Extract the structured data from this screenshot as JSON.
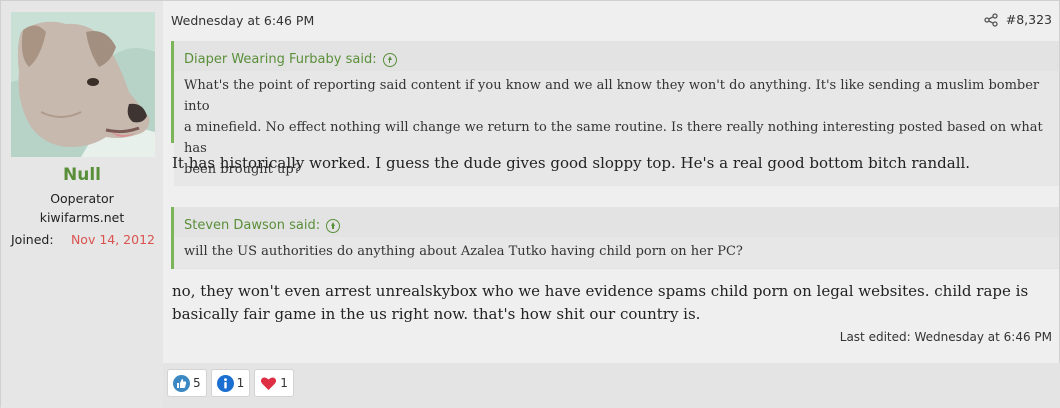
{
  "user": {
    "name": "Null",
    "title": "Ooperator",
    "site": "kiwifarms.net",
    "joined_label": "Joined:",
    "joined_value": "Nov 14, 2012"
  },
  "post": {
    "date": "Wednesday at 6:46 PM",
    "number": "#8,323",
    "quotes": [
      {
        "author": "Diaper Wearing Furbaby said:",
        "lines": [
          "What's the point of reporting said content if you know and we all know they won't do anything. It's like sending a muslim bomber into",
          "a minefield. No effect nothing will change we return to the same routine. Is there really nothing interesting posted based on what has",
          "been brought up?"
        ]
      },
      {
        "author": "Steven Dawson said:",
        "lines": [
          "will the US authorities do anything about Azalea Tutko having child porn on her PC?"
        ]
      }
    ],
    "paragraphs": [
      "It has historically worked. I guess the dude gives good sloppy top. He's a real good bottom bitch randall.",
      "no, they won't even arrest unrealskybox who we have evidence spams child porn on legal websites. child rape is",
      "basically fair game in the us right now. that's how shit our country is."
    ],
    "last_edited": "Last edited: Wednesday at 6:46 PM"
  },
  "reactions": [
    {
      "icon": "thumbs-up-icon",
      "count": "5",
      "color": "#3b88c3"
    },
    {
      "icon": "info-icon",
      "count": "1",
      "color": "#1a6fd1"
    },
    {
      "icon": "heart-icon",
      "count": "1",
      "color": "#dd2e44"
    }
  ],
  "colors": {
    "accent_green": "#5a8f3a",
    "quote_border": "#7cb45a",
    "joined_date": "#d9534f"
  }
}
